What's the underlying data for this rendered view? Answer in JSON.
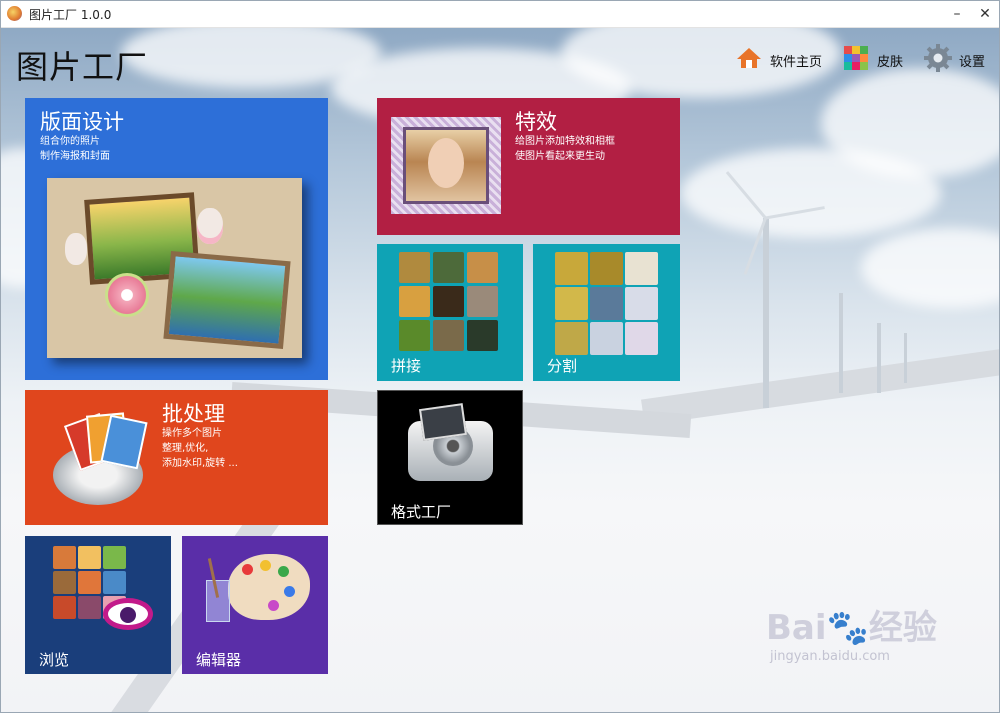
{
  "window": {
    "title": "图片工厂 1.0.0",
    "minimize_glyph": "–",
    "close_glyph": "✕"
  },
  "header": {
    "app_title": "图片工厂",
    "buttons": [
      {
        "label": "软件主页",
        "icon": "home-icon"
      },
      {
        "label": "皮肤",
        "icon": "skin-palette-icon"
      },
      {
        "label": "设置",
        "icon": "gear-icon"
      }
    ]
  },
  "tiles": {
    "layout": {
      "title": "版面设计",
      "desc1": "组合你的照片",
      "desc2": "制作海报和封面",
      "color": "#2d6fd8"
    },
    "effects": {
      "title": "特效",
      "desc1": "给图片添加特效和相框",
      "desc2": "使图片看起来更生动",
      "color": "#b21f43"
    },
    "collage": {
      "label": "拼接",
      "color": "#0fa3b5"
    },
    "split": {
      "label": "分割",
      "color": "#0fa3b5"
    },
    "batch": {
      "title": "批处理",
      "desc1": "操作多个图片",
      "desc2": "整理,优化,",
      "desc3": "添加水印,旋转 ...",
      "color": "#e0461d"
    },
    "format": {
      "label": "格式工厂",
      "color": "#000000"
    },
    "browse": {
      "label": "浏览",
      "color": "#1a3e7b"
    },
    "editor": {
      "label": "编辑器",
      "color": "#5a2ea8"
    }
  },
  "watermark": {
    "brand": "Bai🐾经验",
    "url": "jingyan.baidu.com"
  }
}
